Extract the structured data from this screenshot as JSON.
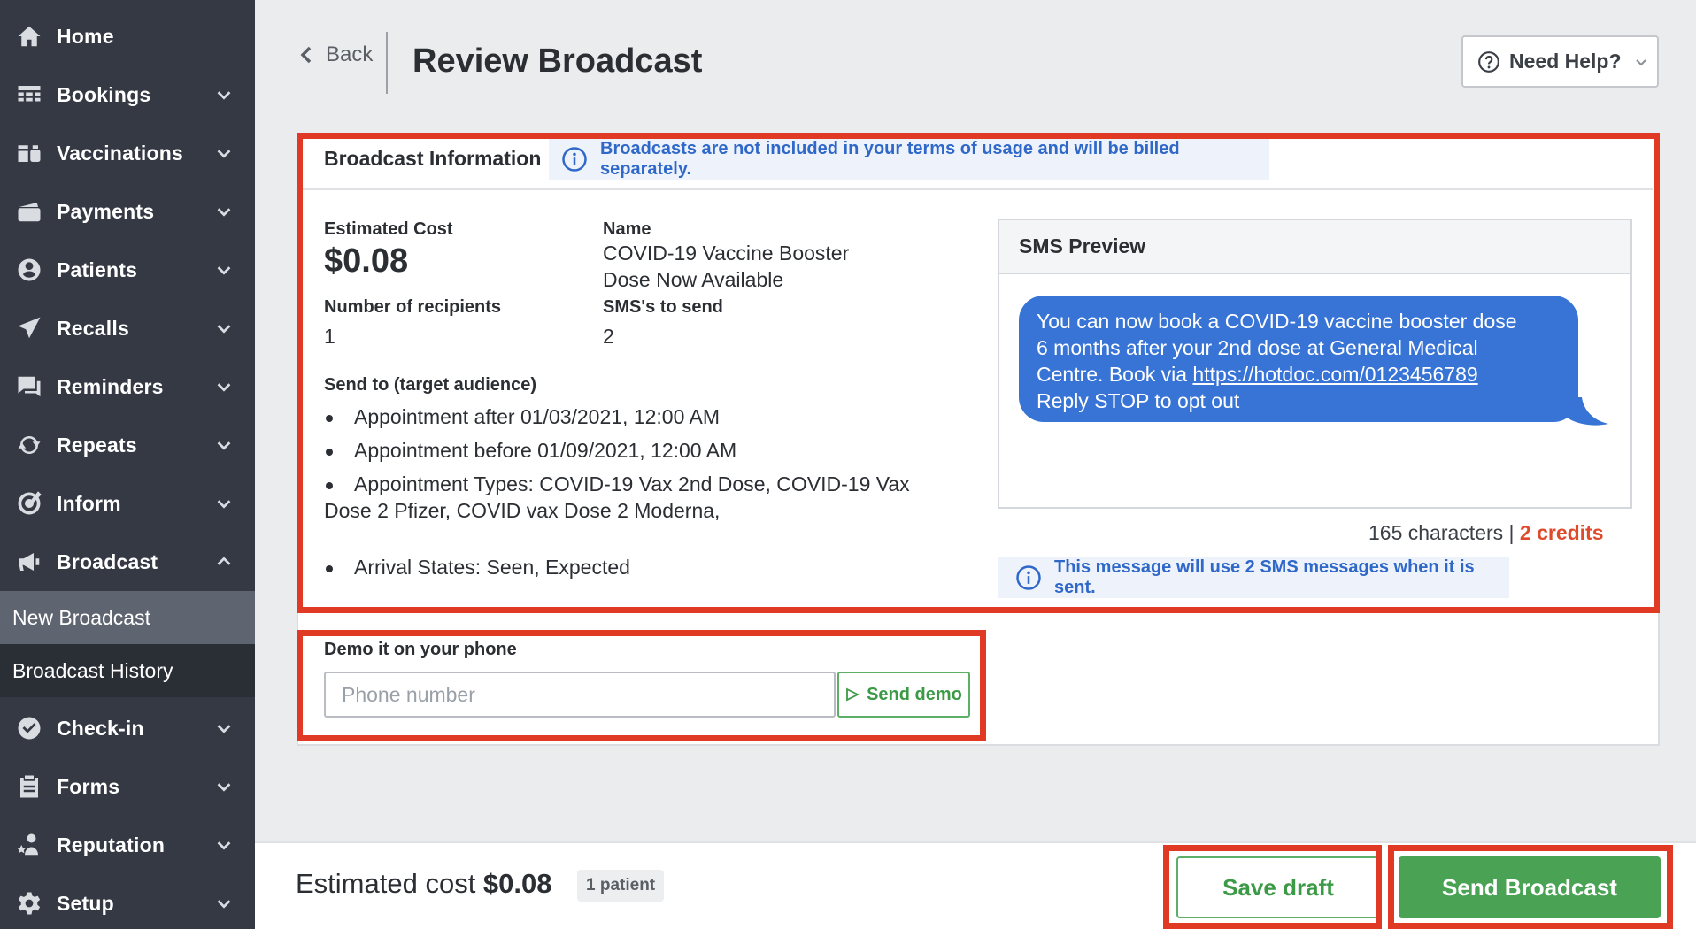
{
  "sidebar": {
    "items": [
      {
        "label": "Home",
        "icon": "home-icon"
      },
      {
        "label": "Bookings",
        "icon": "calendar-grid-icon"
      },
      {
        "label": "Vaccinations",
        "icon": "vaccine-icon"
      },
      {
        "label": "Payments",
        "icon": "credit-card-icon"
      },
      {
        "label": "Patients",
        "icon": "user-circle-icon"
      },
      {
        "label": "Recalls",
        "icon": "paper-plane-icon"
      },
      {
        "label": "Reminders",
        "icon": "chat-icon"
      },
      {
        "label": "Repeats",
        "icon": "refresh-icon"
      },
      {
        "label": "Inform",
        "icon": "target-icon"
      },
      {
        "label": "Broadcast",
        "icon": "megaphone-icon"
      },
      {
        "label": "Check-in",
        "icon": "check-badge-icon"
      },
      {
        "label": "Forms",
        "icon": "clipboard-icon"
      },
      {
        "label": "Reputation",
        "icon": "person-star-icon"
      },
      {
        "label": "Setup",
        "icon": "gear-icon"
      }
    ],
    "broadcast_sub": {
      "new": "New Broadcast",
      "history": "Broadcast History"
    }
  },
  "header": {
    "back_label": "Back",
    "title": "Review Broadcast",
    "help_label": "Need Help?"
  },
  "info": {
    "section_title": "Broadcast Information",
    "billing_notice": "Broadcasts are not included in your terms of usage and will be billed separately.",
    "estimated_cost_label": "Estimated Cost",
    "estimated_cost": "$0.08",
    "name_label": "Name",
    "name_line1": "COVID-19 Vaccine Booster",
    "name_line2": "Dose Now Available",
    "recipients_label": "Number of recipients",
    "recipients": "1",
    "sms_label": "SMS's to send",
    "sms_count": "2",
    "audience_label": "Send to (target audience)",
    "audience": [
      "Appointment after 01/03/2021, 12:00 AM",
      "Appointment before 01/09/2021, 12:00 AM",
      "Appointment Types: COVID-19 Vax 2nd Dose, COVID-19 Vax",
      "Dose 2 Pfizer, COVID vax Dose 2 Moderna,",
      "Arrival States: Seen, Expected"
    ]
  },
  "sms": {
    "title": "SMS Preview",
    "line1": "You can now book a COVID-19 vaccine booster dose",
    "line2": "6 months after your 2nd dose at General Medical",
    "line3_prefix": "Centre. Book via ",
    "link": "https://hotdoc.com/0123456789",
    "line4": "Reply STOP to opt out",
    "characters": "165 characters",
    "separator": " | ",
    "credits": "2 credits",
    "notice": "This message will use 2 SMS messages when it is sent."
  },
  "demo": {
    "label": "Demo it on your phone",
    "placeholder": "Phone number",
    "button": "Send demo"
  },
  "footer": {
    "cost_prefix": "Estimated cost ",
    "cost": "$0.08",
    "patients": "1 patient",
    "save_label": "Save draft",
    "send_label": "Send Broadcast"
  },
  "colors": {
    "sidebar": "#343943",
    "accent_green": "#4aa354",
    "info_blue": "#2f68c9",
    "bubble_blue": "#3874d6",
    "highlight_red": "#e03a24"
  }
}
